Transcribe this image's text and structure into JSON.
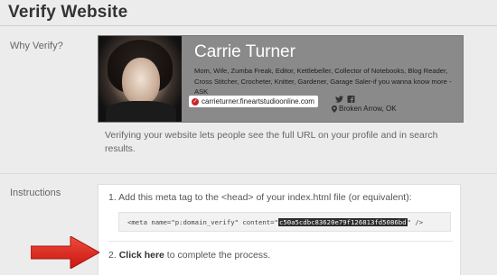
{
  "page": {
    "title": "Verify Website"
  },
  "why_verify": {
    "label": "Why Verify?",
    "description": "Verifying your website lets people see the full URL on your profile and in search results."
  },
  "profile": {
    "name": "Carrie Turner",
    "bio": "Mom, Wife, Zumba Freak, Editor, Kettlebeller, Collector of Notebooks, Blog Reader, Cross Stitcher, Crocheter, Knitter, Gardener, Garage Saler-if you wanna know more - ASK",
    "website": "carrieturner.fineartstudioonline.com",
    "location": "Broken Arrow, OK",
    "icons": {
      "verified": "verified-check-icon",
      "twitter": "twitter-icon",
      "facebook": "facebook-icon",
      "location": "location-pin-icon"
    },
    "colors": {
      "card_bg": "#8a8a8a",
      "name": "#ffffff",
      "verified": "#c8232c"
    }
  },
  "instructions": {
    "label": "Instructions",
    "step1": "1. Add this meta tag to the <head> of your index.html file (or equivalent):",
    "code_prefix": "<meta name=\"p:domain_verify\" content=\"",
    "code_value": "c50a5cdbc83620e79f126813fd5086bd",
    "code_suffix": "\" />",
    "step2_prefix": "2. ",
    "step2_link": "Click here",
    "step2_suffix": " to complete the process."
  },
  "annotation": {
    "arrow_color": "#e0201f",
    "icon": "red-arrow-icon"
  }
}
